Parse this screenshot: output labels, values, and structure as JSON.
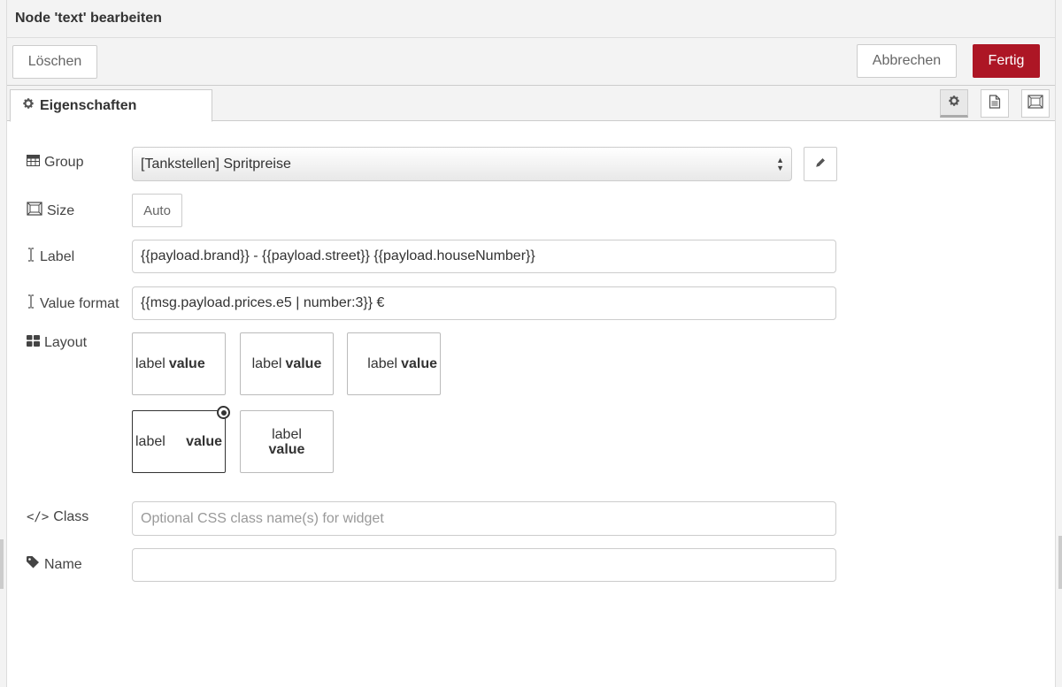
{
  "tray": {
    "title": "Node 'text' bearbeiten"
  },
  "toolbar": {
    "delete_label": "Löschen",
    "cancel_label": "Abbrechen",
    "done_label": "Fertig"
  },
  "tabs": {
    "properties_label": "Eigenschaften"
  },
  "form": {
    "group": {
      "label": "Group",
      "value": "[Tankstellen] Spritpreise"
    },
    "size": {
      "label": "Size",
      "value": "Auto"
    },
    "label": {
      "label": "Label",
      "value": "{{payload.brand}} - {{payload.street}} {{payload.houseNumber}}"
    },
    "value_format": {
      "label": "Value format",
      "value": "{{msg.payload.prices.e5 | number:3}} €"
    },
    "layout": {
      "label": "Layout",
      "options": [
        {
          "label": "label",
          "value": "value"
        },
        {
          "label": "label",
          "value": "value"
        },
        {
          "label": "label",
          "value": "value"
        },
        {
          "label": "label",
          "value": "value"
        },
        {
          "label": "label",
          "value": "value"
        }
      ],
      "selected_index": 3
    },
    "class": {
      "label": "Class",
      "placeholder": "Optional CSS class name(s) for widget",
      "value": ""
    },
    "name": {
      "label": "Name",
      "value": ""
    }
  },
  "colors": {
    "primary_button": "#ad1625",
    "border": "#cccccc",
    "header_bg": "#f3f3f3"
  }
}
